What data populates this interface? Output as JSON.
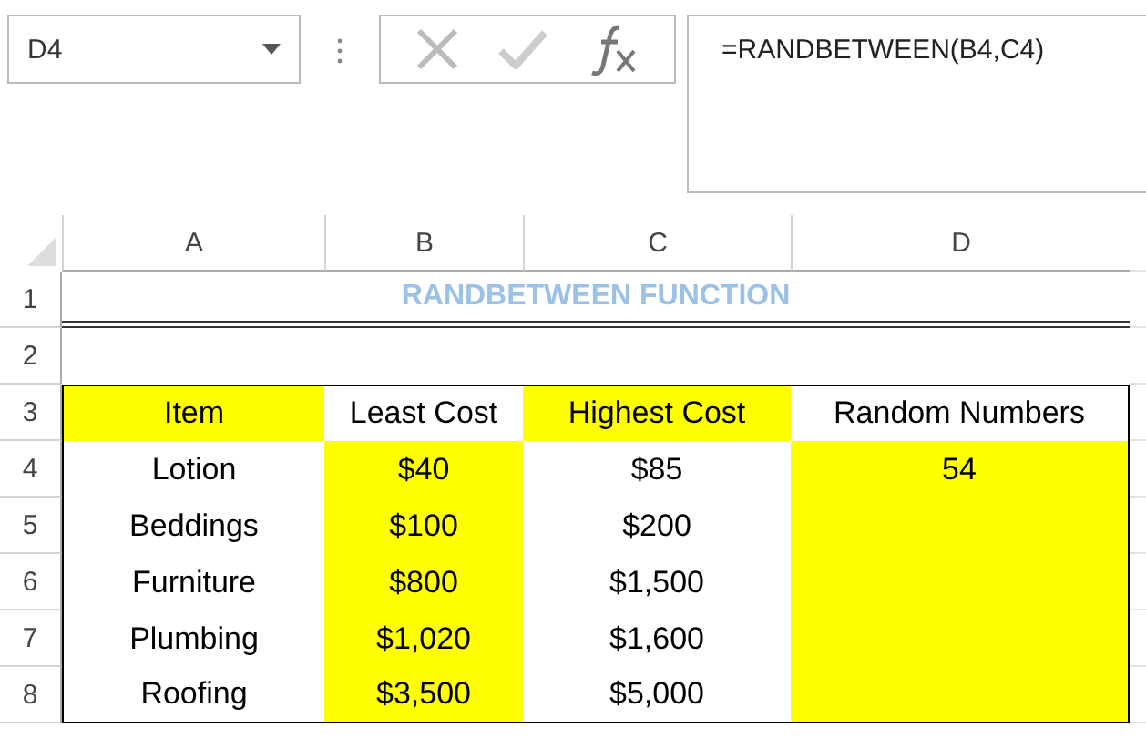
{
  "name_box": {
    "value": "D4"
  },
  "formula_bar": {
    "value": "=RANDBETWEEN(B4,C4)"
  },
  "column_headers": [
    "A",
    "B",
    "C",
    "D"
  ],
  "rows": [
    {
      "number": "1",
      "kind": "title",
      "title": "RANDBETWEEN FUNCTION"
    },
    {
      "number": "2",
      "kind": "blank"
    },
    {
      "number": "3",
      "kind": "cells",
      "cells": [
        {
          "text": "Item",
          "highlighted": true
        },
        {
          "text": "Least Cost",
          "highlighted": false
        },
        {
          "text": "Highest Cost",
          "highlighted": true
        },
        {
          "text": "Random Numbers",
          "highlighted": false
        }
      ]
    },
    {
      "number": "4",
      "kind": "cells",
      "cells": [
        {
          "text": "Lotion",
          "highlighted": false
        },
        {
          "text": "$40",
          "highlighted": true
        },
        {
          "text": "$85",
          "highlighted": false
        },
        {
          "text": "54",
          "highlighted": true
        }
      ]
    },
    {
      "number": "5",
      "kind": "cells",
      "cells": [
        {
          "text": "Beddings",
          "highlighted": false
        },
        {
          "text": "$100",
          "highlighted": true
        },
        {
          "text": "$200",
          "highlighted": false
        },
        {
          "highlighted": true
        }
      ]
    },
    {
      "number": "6",
      "kind": "cells",
      "cells": [
        {
          "text": "Furniture",
          "highlighted": false
        },
        {
          "text": "$800",
          "highlighted": true
        },
        {
          "text": "$1,500",
          "highlighted": false
        },
        {
          "highlighted": true
        }
      ]
    },
    {
      "number": "7",
      "kind": "cells",
      "cells": [
        {
          "text": "Plumbing",
          "highlighted": false
        },
        {
          "text": "$1,020",
          "highlighted": true
        },
        {
          "text": "$1,600",
          "highlighted": false
        },
        {
          "highlighted": true
        }
      ]
    },
    {
      "number": "8",
      "kind": "cells",
      "cells": [
        {
          "text": "Roofing",
          "highlighted": false
        },
        {
          "text": "$3,500",
          "highlighted": true
        },
        {
          "text": "$5,000",
          "highlighted": false
        },
        {
          "highlighted": true
        }
      ]
    }
  ]
}
